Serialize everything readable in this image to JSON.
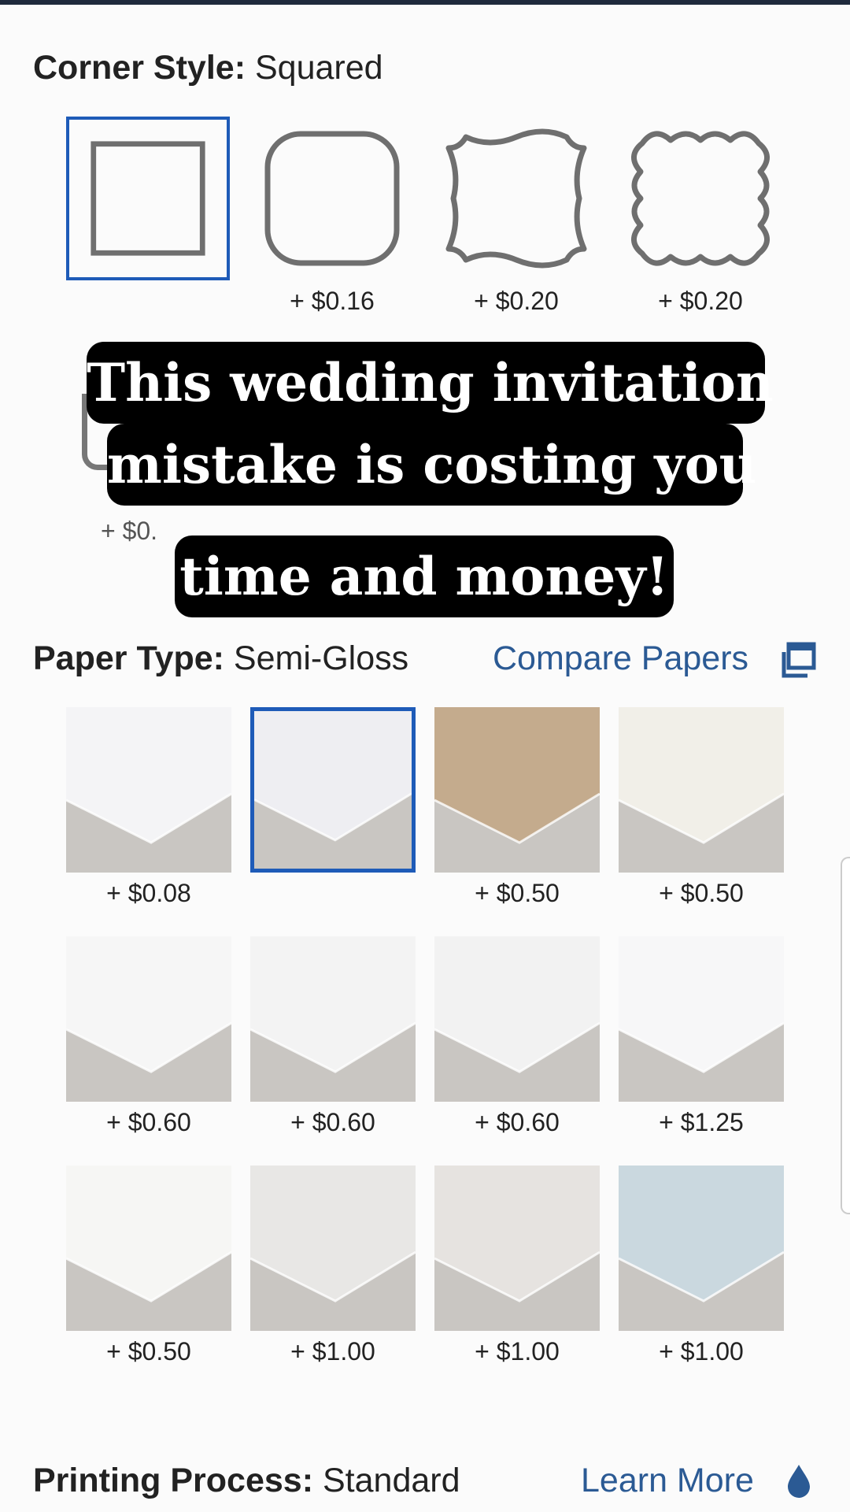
{
  "corner_style": {
    "label": "Corner Style:",
    "value": "Squared",
    "options": [
      {
        "icon": "square-corner-icon",
        "price": "",
        "selected": true
      },
      {
        "icon": "rounded-corner-icon",
        "price": "+ $0.16",
        "selected": false
      },
      {
        "icon": "ticket-corner-icon",
        "price": "+ $0.20",
        "selected": false
      },
      {
        "icon": "scalloped-corner-icon",
        "price": "+ $0.20",
        "selected": false
      }
    ]
  },
  "overlay": {
    "lines": [
      "This wedding invitation",
      "mistake is costing you",
      "time and money!"
    ]
  },
  "hidden_partial_price": "+ $0.",
  "paper_type": {
    "label": "Paper Type:",
    "value": "Semi-Gloss",
    "compare_link": "Compare Papers",
    "compare_icon": "external-window-icon",
    "options": [
      {
        "price": "+ $0.08",
        "color": "#f4f4f6",
        "selected": false
      },
      {
        "price": "",
        "color": "#eeeef2",
        "selected": true
      },
      {
        "price": "+ $0.50",
        "color": "#c4ab8d",
        "selected": false
      },
      {
        "price": "+ $0.50",
        "color": "#f1efe8",
        "selected": false
      },
      {
        "price": "+ $0.60",
        "color": "#f6f6f6",
        "selected": false
      },
      {
        "price": "+ $0.60",
        "color": "#f3f3f3",
        "selected": false
      },
      {
        "price": "+ $0.60",
        "color": "#f2f2f2",
        "selected": false
      },
      {
        "price": "+ $1.25",
        "color": "#f7f7f8",
        "selected": false
      },
      {
        "price": "+ $0.50",
        "color": "#f6f6f4",
        "selected": false
      },
      {
        "price": "+ $1.00",
        "color": "#e8e7e5",
        "selected": false
      },
      {
        "price": "+ $1.00",
        "color": "#e6e3e0",
        "selected": false
      },
      {
        "price": "+ $1.00",
        "color": "#cad8df",
        "selected": false
      }
    ]
  },
  "printing_process": {
    "label": "Printing Process:",
    "value": "Standard",
    "learn_more": "Learn More",
    "learn_icon": "ink-drop-icon"
  },
  "colors": {
    "accent": "#1e5bb8",
    "link": "#2b5a94",
    "overlay_bg": "#000000"
  }
}
